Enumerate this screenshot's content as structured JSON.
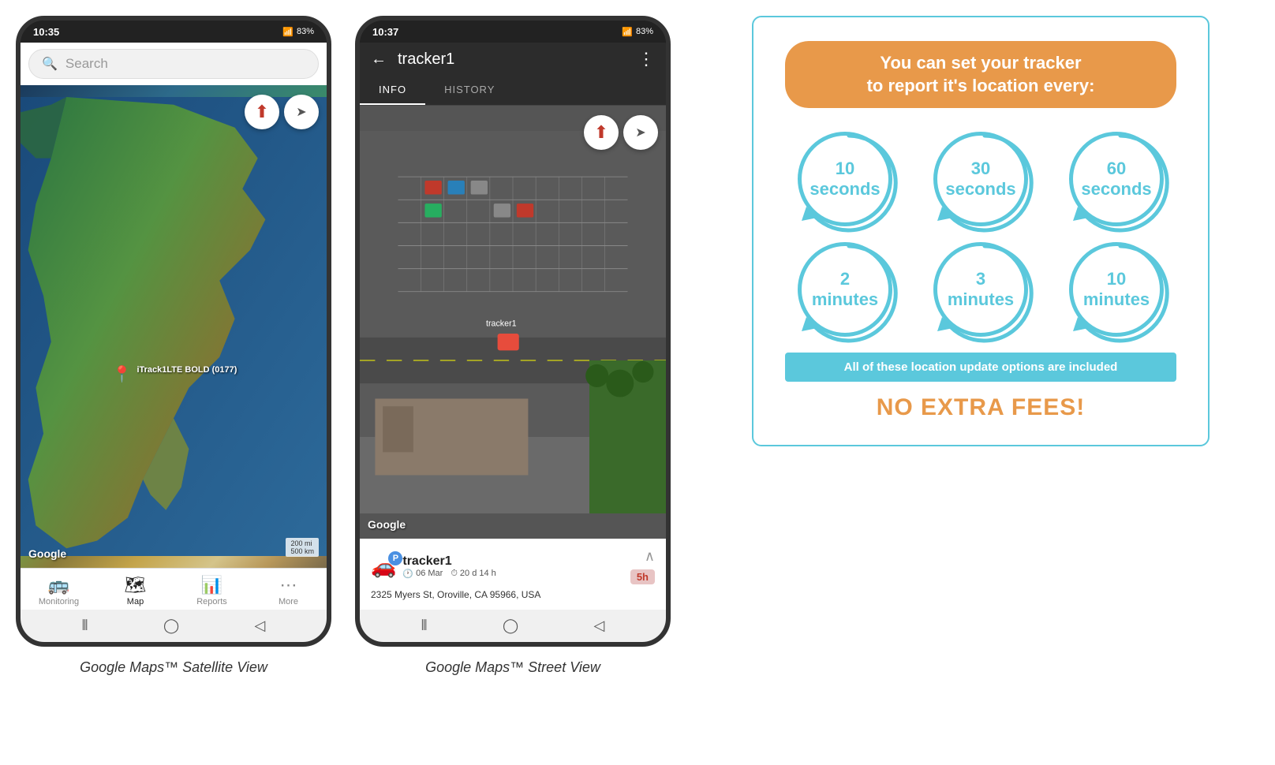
{
  "phone1": {
    "status_time": "10:35",
    "status_signal": "▲.ill",
    "status_battery": "83%",
    "search_placeholder": "Search",
    "compass": "⬆",
    "share_icon": "➤",
    "tracker_label": "iTrack1LTE BOLD (0177)",
    "google_logo": "Google",
    "scale_200mi": "200 mi",
    "scale_500km": "500 km",
    "nav_items": [
      {
        "icon": "🚌",
        "label": "Monitoring",
        "active": false
      },
      {
        "icon": "🗺",
        "label": "Map",
        "active": true
      },
      {
        "icon": "📊",
        "label": "Reports",
        "active": false
      },
      {
        "icon": "⋯",
        "label": "More",
        "active": false
      }
    ],
    "nav_buttons": [
      "⦀",
      "◯",
      "◁"
    ],
    "caption": "Google Maps™ Satellite View"
  },
  "phone2": {
    "status_time": "10:37",
    "status_signal": "▲.ill",
    "status_battery": "83%",
    "back_icon": "←",
    "tracker_title": "tracker1",
    "more_icon": "⋮",
    "tabs": [
      {
        "label": "INFO",
        "active": true
      },
      {
        "label": "HISTORY",
        "active": false
      }
    ],
    "compass": "⬆",
    "share_icon": "➤",
    "google_logo": "Google",
    "tracker_info": {
      "car_icon": "🚗",
      "p_badge": "P",
      "name": "tracker1",
      "date": "06 Mar",
      "duration": "20 d 14 h",
      "address": "2325 Myers St, Oroville, CA 95966, USA",
      "time_badge": "5h"
    },
    "nav_buttons": [
      "⦀",
      "◯",
      "◁"
    ],
    "caption": "Google Maps™ Street View"
  },
  "info_panel": {
    "header_line1": "You can set your tracker",
    "header_line2": "to report it's location every:",
    "circles": [
      {
        "value": "10",
        "unit": "seconds"
      },
      {
        "value": "30",
        "unit": "seconds"
      },
      {
        "value": "60",
        "unit": "seconds"
      },
      {
        "value": "2",
        "unit": "minutes"
      },
      {
        "value": "3",
        "unit": "minutes"
      },
      {
        "value": "10",
        "unit": "minutes"
      }
    ],
    "included_text": "All of these location update options are included",
    "no_fees_text": "NO EXTRA FEES!"
  }
}
